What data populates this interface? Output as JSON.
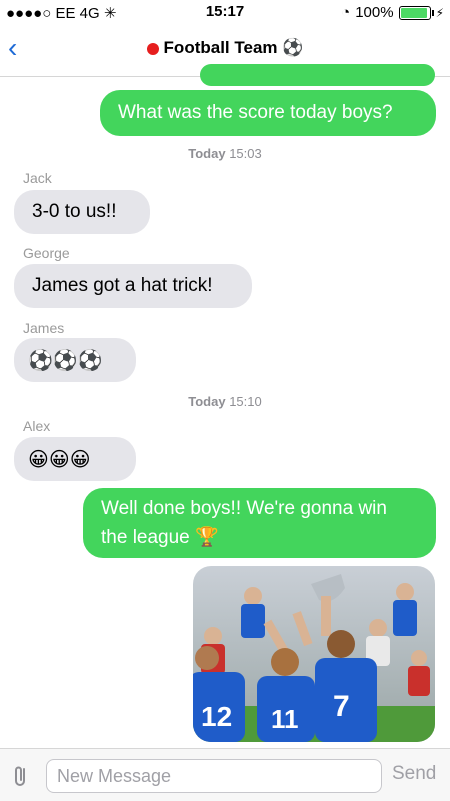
{
  "status": {
    "carrier": "●●●●○ EE  4G ✳",
    "time": "15:17",
    "battery": "100%"
  },
  "header": {
    "title": "Football Team",
    "emoji": "⚽"
  },
  "timestamps": [
    {
      "day": "Today",
      "time": "15:03"
    },
    {
      "day": "Today",
      "time": "15:10"
    }
  ],
  "messages": {
    "m1": "What was the score today boys?",
    "m2_sender": "Jack",
    "m2": "3-0 to us!!",
    "m3_sender": "George",
    "m3": "James got a hat trick!",
    "m4_sender": "James",
    "m4": "⚽⚽⚽",
    "m5_sender": "Alex",
    "m5": "😀😀😀",
    "m6": "Well done boys!! We're gonna win the league 🏆"
  },
  "compose": {
    "placeholder": "New Message",
    "send": "Send"
  }
}
